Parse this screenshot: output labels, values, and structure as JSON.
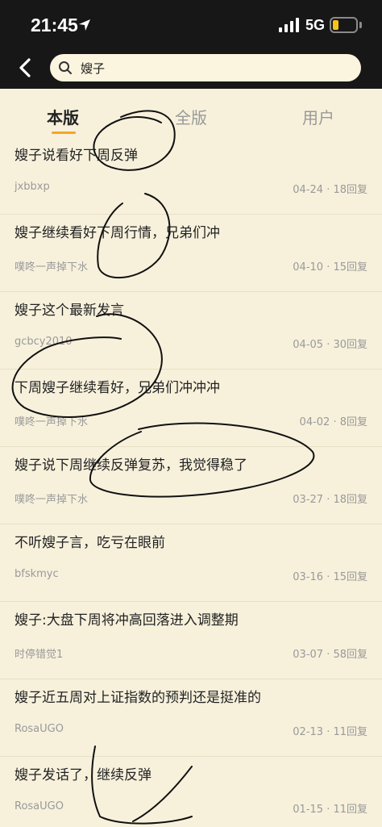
{
  "status_bar": {
    "time": "21:45",
    "network": "5G",
    "battery_level": 0.25,
    "battery_color": "#f5c518"
  },
  "search": {
    "query": "嫂子"
  },
  "tabs": [
    {
      "label": "本版",
      "active": true
    },
    {
      "label": "全版",
      "active": false
    },
    {
      "label": "用户",
      "active": false
    }
  ],
  "accent_color": "#f5a623",
  "posts": [
    {
      "title": "嫂子说看好下周反弹",
      "author": "jxbbxp",
      "meta": "04-24 · 18回复"
    },
    {
      "title": "嫂子继续看好下周行情，兄弟们冲",
      "author": "噗咚一声掉下水",
      "meta": "04-10 · 15回复"
    },
    {
      "title": "嫂子这个最新发言",
      "author": "gcbcy2010",
      "meta": "04-05 · 30回复"
    },
    {
      "title": "下周嫂子继续看好，兄弟们冲冲冲",
      "author": "噗咚一声掉下水",
      "meta": "04-02 · 8回复"
    },
    {
      "title": "嫂子说下周继续反弹复苏，我觉得稳了",
      "author": "噗咚一声掉下水",
      "meta": "03-27 · 18回复"
    },
    {
      "title": "不听嫂子言，吃亏在眼前",
      "author": "bfskmyc",
      "meta": "03-16 · 15回复"
    },
    {
      "title": "嫂子:大盘下周将冲高回落进入调整期",
      "author": "时停错觉1",
      "meta": "03-07 · 58回复"
    },
    {
      "title": "嫂子近五周对上证指数的预判还是挺准的",
      "author": "RosaUGO",
      "meta": "02-13 · 11回复"
    },
    {
      "title": "嫂子发话了，继续反弹",
      "author": "RosaUGO",
      "meta": "01-15 · 11回复"
    }
  ],
  "icons": {
    "back": "back-arrow-icon",
    "search": "search-icon",
    "location": "location-arrow-icon",
    "signal": "signal-bars-icon",
    "battery": "battery-icon"
  }
}
